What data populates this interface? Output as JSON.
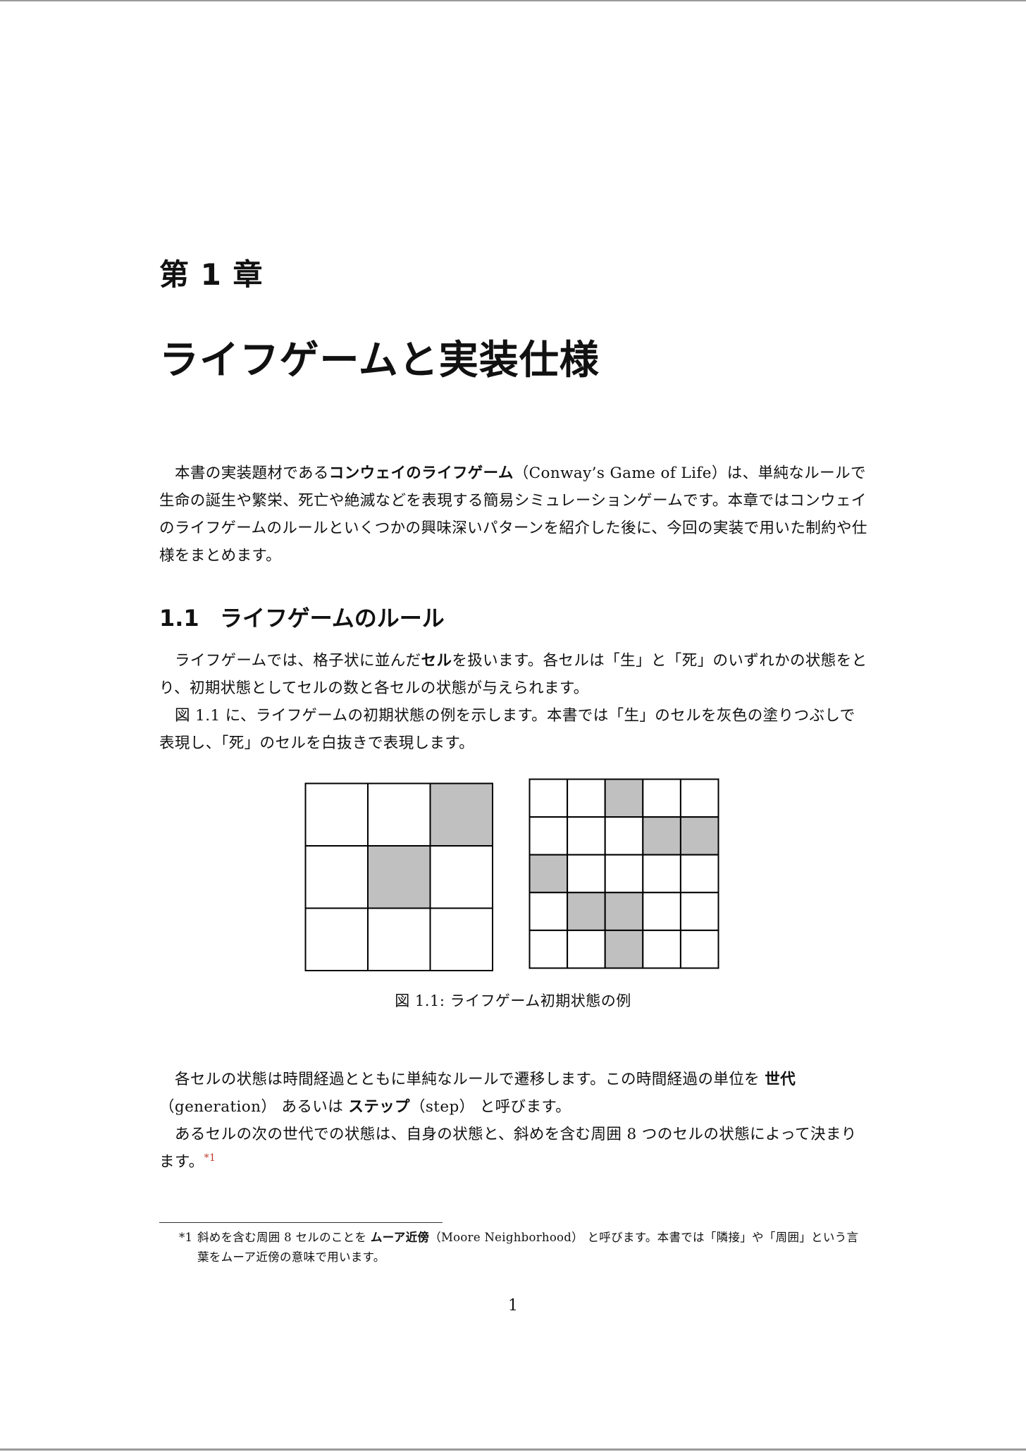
{
  "chapter": {
    "label": "第 1 章",
    "title": "ライフゲームと実装仕様"
  },
  "intro": {
    "pre": "本書の実装題材である",
    "bold": "コンウェイのライフゲーム",
    "post": "（Conway’s Game of Life）は、単純なルールで生命の誕生や繁栄、死亡や絶滅などを表現する簡易シミュレーションゲームです。本章ではコンウェイのライフゲームのルールといくつかの興味深いパターンを紹介した後に、今回の実装で用いた制約や仕様をまとめます。"
  },
  "section": {
    "number": "1.1",
    "title": "ライフゲームのルール"
  },
  "para2": {
    "pre": "ライフゲームでは、格子状に並んだ",
    "bold": "セル",
    "post": "を扱います。各セルは「生」と「死」のいずれかの状態をとり、初期状態としてセルの数と各セルの状態が与えられます。"
  },
  "para3": "図 1.1 に、ライフゲームの初期状態の例を示します。本書では「生」のセルを灰色の塗りつぶしで表現し、「死」のセルを白抜きで表現します。",
  "figure": {
    "caption": "図 1.1: ライフゲーム初期状態の例",
    "live_color": "#c0c0c0",
    "dead_color": "#ffffff",
    "grids": [
      {
        "name": "grid-3x3",
        "rows": [
          [
            0,
            0,
            1
          ],
          [
            0,
            1,
            0
          ],
          [
            0,
            0,
            0
          ]
        ]
      },
      {
        "name": "grid-5x5",
        "rows": [
          [
            0,
            0,
            1,
            0,
            0
          ],
          [
            0,
            0,
            0,
            1,
            1
          ],
          [
            1,
            0,
            0,
            0,
            0
          ],
          [
            0,
            1,
            1,
            0,
            0
          ],
          [
            0,
            0,
            1,
            0,
            0
          ]
        ]
      }
    ]
  },
  "para4": {
    "pre": "各セルの状態は時間経過とともに単純なルールで遷移します。この時間経過の単位を ",
    "bold1": "世代",
    "mid": "（generation） あるいは ",
    "bold2": "ステップ",
    "post": "（step） と呼びます。"
  },
  "para5": {
    "text": "あるセルの次の世代での状態は、自身の状態と、斜めを含む周囲 8 つのセルの状態によって決まります。",
    "ref": "*1"
  },
  "footnote": {
    "mark": "*1",
    "pre": "斜めを含む周囲 8 セルのことを ",
    "bold": "ムーア近傍",
    "post": "（Moore Neighborhood） と呼びます。本書では「隣接」や「周囲」という言葉をムーア近傍の意味で用います。"
  },
  "page_number": "1"
}
